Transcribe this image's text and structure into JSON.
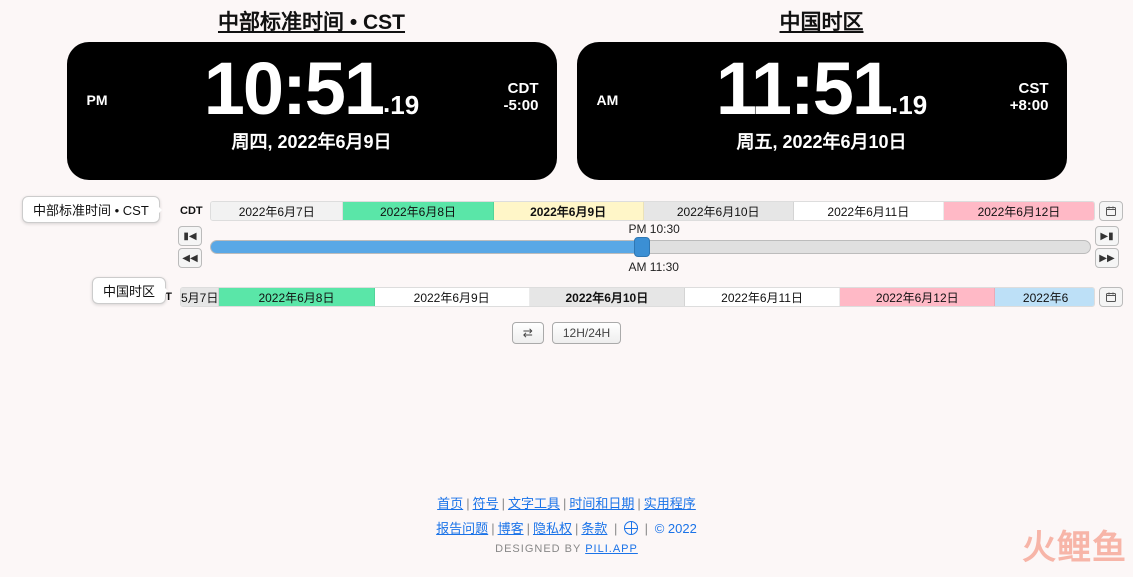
{
  "clocks": [
    {
      "title": "中部标准时间 • CST",
      "ampm": "PM",
      "time": "10:51",
      "sec": "19",
      "tz": "CDT",
      "offset": "-5:00",
      "date": "周四, 2022年6月9日"
    },
    {
      "title": "中国时区",
      "ampm": "AM",
      "time": "11:51",
      "sec": "19",
      "tz": "CST",
      "offset": "+8:00",
      "date": "周五, 2022年6月10日"
    }
  ],
  "track1": {
    "label": "中部标准时间 • CST",
    "abbr": "CDT",
    "segs": [
      {
        "t": "2022年6月7日",
        "c": "#f2f2f2",
        "w": 15
      },
      {
        "t": "2022年6月8日",
        "c": "#5ae6a8",
        "w": 17
      },
      {
        "t": "2022年6月9日",
        "c": "#fff6c8",
        "w": 17,
        "bold": true
      },
      {
        "t": "2022年6月10日",
        "c": "#e6e6e6",
        "w": 17
      },
      {
        "t": "2022年6月11日",
        "c": "#ffffff",
        "w": 17
      },
      {
        "t": "2022年6月12日",
        "c": "#ffb9c6",
        "w": 17
      }
    ]
  },
  "track2": {
    "label": "中国时区",
    "abbr": "CST",
    "segs": [
      {
        "t": "5月7日",
        "c": "#e6e6e6",
        "w": 4
      },
      {
        "t": "2022年6月8日",
        "c": "#5ae6a8",
        "w": 17
      },
      {
        "t": "2022年6月9日",
        "c": "#ffffff",
        "w": 17
      },
      {
        "t": "2022年6月10日",
        "c": "#e6e6e6",
        "w": 17,
        "bold": true
      },
      {
        "t": "2022年6月11日",
        "c": "#ffffff",
        "w": 17
      },
      {
        "t": "2022年6月12日",
        "c": "#ffb9c6",
        "w": 17
      },
      {
        "t": "2022年6",
        "c": "#bde0f7",
        "w": 11
      }
    ]
  },
  "slider": {
    "top": "PM 10:30",
    "bottom": "AM 11:30",
    "value": 48.5
  },
  "buttons": {
    "swap": "⇄",
    "fmt": "12H/24H"
  },
  "footer": {
    "row1": [
      "首页",
      "符号",
      "文字工具",
      "时间和日期",
      "实用程序"
    ],
    "row2": [
      "报告问题",
      "博客",
      "隐私权",
      "条款"
    ],
    "copy": "© 2022",
    "design_prefix": "DESIGNED BY ",
    "design_link": "PILI.APP"
  },
  "watermark": "火鲤鱼"
}
